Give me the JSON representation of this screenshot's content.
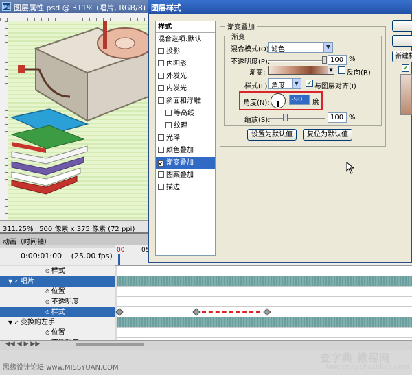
{
  "document": {
    "title": "图层属性.psd @ 311% (唱片, RGB/8)",
    "app_icon": "Ps",
    "status_zoom": "311.25%",
    "status_info": "500 像素 x 375 像素 (72 ppi)"
  },
  "dialog": {
    "title": "图层样式",
    "styles_header": "样式",
    "blend_options": "混合选项:默认",
    "effects": [
      {
        "label": "投影",
        "checked": false,
        "indent": false
      },
      {
        "label": "内阴影",
        "checked": false,
        "indent": false
      },
      {
        "label": "外发光",
        "checked": false,
        "indent": false
      },
      {
        "label": "内发光",
        "checked": false,
        "indent": false
      },
      {
        "label": "斜面和浮雕",
        "checked": false,
        "indent": false
      },
      {
        "label": "等高线",
        "checked": false,
        "indent": true
      },
      {
        "label": "纹理",
        "checked": false,
        "indent": true
      },
      {
        "label": "光泽",
        "checked": false,
        "indent": false
      },
      {
        "label": "颜色叠加",
        "checked": false,
        "indent": false
      },
      {
        "label": "渐变叠加",
        "checked": true,
        "indent": false,
        "selected": true
      },
      {
        "label": "图案叠加",
        "checked": false,
        "indent": false
      },
      {
        "label": "描边",
        "checked": false,
        "indent": false
      }
    ],
    "group_title": "渐变叠加",
    "inner_group_title": "渐变",
    "blend_mode_label": "混合模式(O):",
    "blend_mode_value": "滤色",
    "opacity_label": "不透明度(P):",
    "opacity_value": "100",
    "percent": "%",
    "gradient_label": "渐变:",
    "reverse_label": "反向(R)",
    "style_label": "样式(L):",
    "style_value": "角度",
    "align_label": "与图层对齐(I)",
    "angle_label": "角度(N):",
    "angle_value": "-90",
    "angle_unit": "度",
    "scale_label": "缩放(S):",
    "scale_value": "100",
    "reset_default": "设置为默认值",
    "restore_default": "复位为默认值",
    "new_style": "新建样",
    "right_btn_1": "",
    "right_btn_2": ""
  },
  "timeline": {
    "tab": "动画（时间轴）",
    "time": "0:00:01:00",
    "fps": "(25.00 fps)",
    "ruler_start": "00",
    "ruler_next": "05",
    "rows": [
      {
        "label": "样式",
        "kind": "prop",
        "clipped": true
      },
      {
        "label": "唱片",
        "kind": "layer",
        "selected": true
      },
      {
        "label": "位置",
        "kind": "prop"
      },
      {
        "label": "不透明度",
        "kind": "prop"
      },
      {
        "label": "样式",
        "kind": "prop",
        "selected": true,
        "keyframes": [
          0,
          0.26,
          0.5
        ]
      },
      {
        "label": "变换的左手",
        "kind": "layer"
      },
      {
        "label": "位置",
        "kind": "prop"
      },
      {
        "label": "不透明度",
        "kind": "prop"
      }
    ]
  },
  "footer": {
    "left": "思缘设计论坛 www.MISSYUAN.COM",
    "watermark": "查字典 教程网",
    "watermark_url": "jiaocheng.chazidian.com"
  }
}
